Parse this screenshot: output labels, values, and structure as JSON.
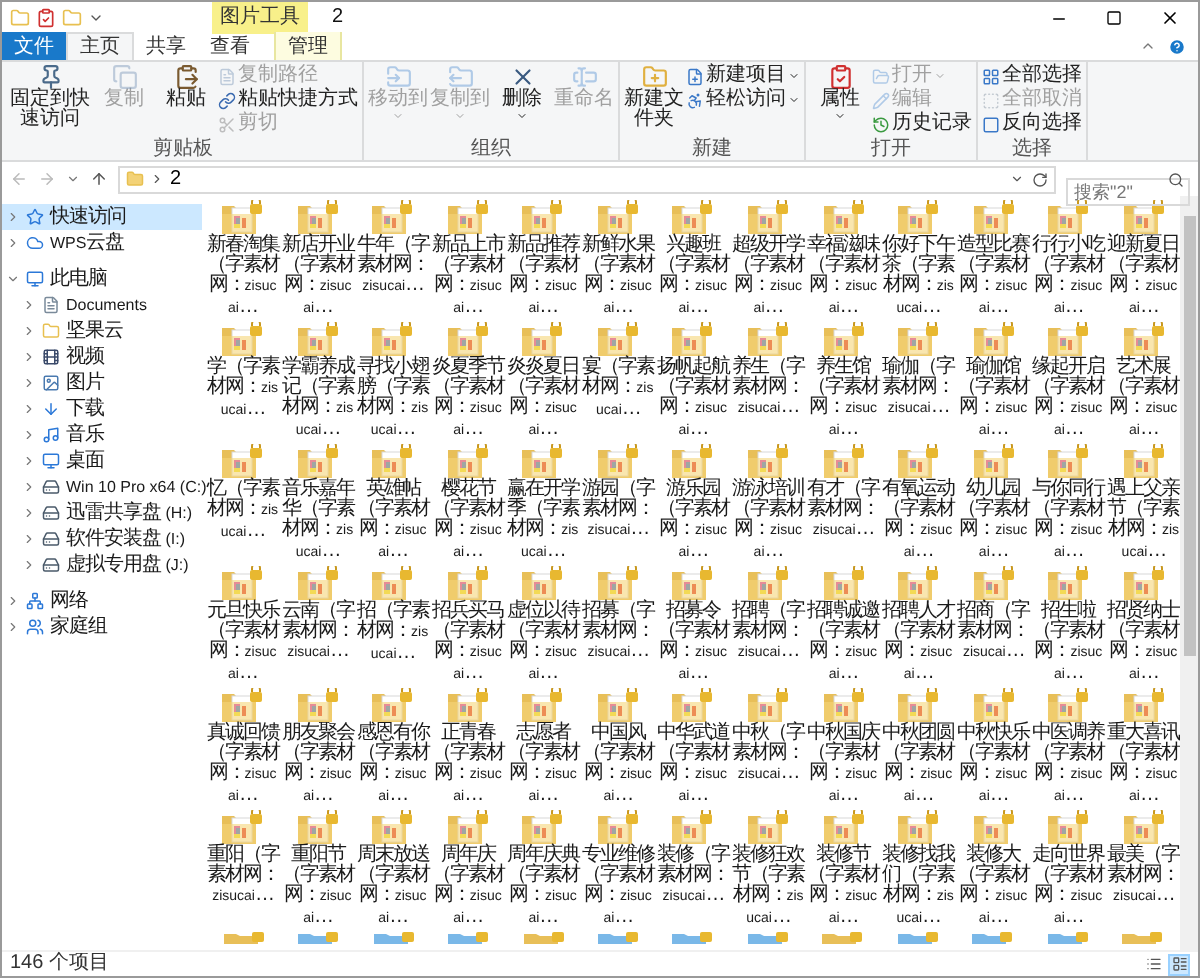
{
  "window": {
    "title": "2",
    "context_tab": "图片工具"
  },
  "ribbon_tabs": [
    {
      "label": "文件",
      "kind": "file",
      "selected": false
    },
    {
      "label": "主页",
      "kind": "tab",
      "selected": true
    },
    {
      "label": "共享",
      "kind": "tab",
      "selected": false
    },
    {
      "label": "查看",
      "kind": "tab",
      "selected": false
    },
    {
      "label": "管理",
      "kind": "context",
      "selected": false
    }
  ],
  "ribbon_groups": [
    {
      "label": "剪贴板",
      "items": [
        {
          "label": "固定到快速访问",
          "kind": "large",
          "disabled": false,
          "dropdown": false
        },
        {
          "label": "复制",
          "kind": "large",
          "disabled": true,
          "dropdown": false
        },
        {
          "label": "粘贴",
          "kind": "large",
          "disabled": false,
          "dropdown": false
        },
        {
          "label": "复制路径",
          "kind": "small",
          "disabled": true,
          "dropdown": false
        },
        {
          "label": "粘贴快捷方式",
          "kind": "small",
          "disabled": false,
          "dropdown": false
        },
        {
          "label": "剪切",
          "kind": "small",
          "disabled": true,
          "dropdown": false
        }
      ]
    },
    {
      "label": "组织",
      "items": [
        {
          "label": "移动到",
          "kind": "large",
          "disabled": true,
          "dropdown": true
        },
        {
          "label": "复制到",
          "kind": "large",
          "disabled": true,
          "dropdown": true
        },
        {
          "label": "删除",
          "kind": "large",
          "disabled": false,
          "dropdown": true
        },
        {
          "label": "重命名",
          "kind": "large",
          "disabled": true,
          "dropdown": false
        }
      ]
    },
    {
      "label": "新建",
      "items": [
        {
          "label": "新建文件夹",
          "kind": "large",
          "disabled": false,
          "dropdown": false
        },
        {
          "label": "新建项目",
          "kind": "small",
          "disabled": false,
          "dropdown": true
        },
        {
          "label": "轻松访问",
          "kind": "small",
          "disabled": false,
          "dropdown": true
        }
      ]
    },
    {
      "label": "打开",
      "items": [
        {
          "label": "属性",
          "kind": "large",
          "disabled": false,
          "dropdown": true
        },
        {
          "label": "打开",
          "kind": "small",
          "disabled": true,
          "dropdown": true
        },
        {
          "label": "编辑",
          "kind": "small",
          "disabled": true,
          "dropdown": false
        },
        {
          "label": "历史记录",
          "kind": "small",
          "disabled": false,
          "dropdown": false
        }
      ]
    },
    {
      "label": "选择",
      "items": [
        {
          "label": "全部选择",
          "kind": "small",
          "disabled": false,
          "dropdown": false
        },
        {
          "label": "全部取消",
          "kind": "small",
          "disabled": true,
          "dropdown": false
        },
        {
          "label": "反向选择",
          "kind": "small",
          "disabled": false,
          "dropdown": false
        }
      ]
    }
  ],
  "address": {
    "path": "2",
    "search_placeholder": "搜索\"2\""
  },
  "nav": [
    {
      "label": "快速访问",
      "selected": true,
      "expanded": false
    },
    {
      "label": "WPS云盘",
      "selected": false,
      "expanded": false
    },
    {
      "label": "此电脑",
      "selected": false,
      "expanded": true,
      "children": [
        {
          "label": "Documents",
          "selected": false,
          "expanded": false
        },
        {
          "label": "坚果云",
          "selected": false,
          "expanded": false
        },
        {
          "label": "视频",
          "selected": false,
          "expanded": false
        },
        {
          "label": "图片",
          "selected": false,
          "expanded": false
        },
        {
          "label": "下载",
          "selected": false,
          "expanded": false
        },
        {
          "label": "音乐",
          "selected": false,
          "expanded": false
        },
        {
          "label": "桌面",
          "selected": false,
          "expanded": false
        },
        {
          "label": "Win 10 Pro x64 (C:)",
          "selected": false,
          "expanded": false
        },
        {
          "label": "迅雷共享盘 (H:)",
          "selected": false,
          "expanded": false
        },
        {
          "label": "软件安装盘 (I:)",
          "selected": false,
          "expanded": false
        },
        {
          "label": "虚拟专用盘 (J:)",
          "selected": false,
          "expanded": false
        }
      ]
    },
    {
      "label": "网络",
      "selected": false,
      "expanded": false
    },
    {
      "label": "家庭组",
      "selected": false,
      "expanded": false
    }
  ],
  "files": [
    {
      "name": "新春淘集（字素材网：zisucai…"
    },
    {
      "name": "新店开业（字素材网：zisucai…"
    },
    {
      "name": "牛年（字素材网：zisucai…"
    },
    {
      "name": "新品上市（字素材网：zisucai…"
    },
    {
      "name": "新品推荐（字素材网：zisucai…"
    },
    {
      "name": "新鲜水果（字素材网：zisucai…"
    },
    {
      "name": "兴趣班（字素材网：zisucai…"
    },
    {
      "name": "超级开学（字素材网：zisucai…"
    },
    {
      "name": "幸福滋味（字素材网：zisucai…"
    },
    {
      "name": "你好下午茶（字素材网：zisucai…"
    },
    {
      "name": "造型比赛（字素材网：zisucai…"
    },
    {
      "name": "行行小吃（字素材网：zisucai…"
    },
    {
      "name": "迎新夏日（字素材网：zisucai…"
    },
    {
      "name": "学（字素材网：zisucai…"
    },
    {
      "name": "学霸养成记（字素材网：zisucai…"
    },
    {
      "name": "寻找小翅膀（字素材网：zisucai…"
    },
    {
      "name": "炎夏季节（字素材网：zisucai…"
    },
    {
      "name": "炎炎夏日（字素材网：zisucai…"
    },
    {
      "name": "宴（字素材网：zisucai…"
    },
    {
      "name": "扬帆起航（字素材网：zisucai…"
    },
    {
      "name": "养生（字素材网：zisucai…"
    },
    {
      "name": "养生馆（字素材网：zisucai…"
    },
    {
      "name": "瑜伽（字素材网：zisucai…"
    },
    {
      "name": "瑜伽馆（字素材网：zisucai…"
    },
    {
      "name": "缘起开启（字素材网：zisucai…"
    },
    {
      "name": "艺术展（字素材网：zisucai…"
    },
    {
      "name": "忆（字素材网：zisucai…"
    },
    {
      "name": "音乐嘉年华（字素材网：zisucai…"
    },
    {
      "name": "英雄帖（字素材网：zisucai…"
    },
    {
      "name": "樱花节（字素材网：zisucai…"
    },
    {
      "name": "赢在开学季（字素材网：zisucai…"
    },
    {
      "name": "游园（字素材网：zisucai…"
    },
    {
      "name": "游乐园（字素材网：zisucai…"
    },
    {
      "name": "游泳培训（字素材网：zisucai…"
    },
    {
      "name": "有才（字素材网：zisucai…"
    },
    {
      "name": "有氧运动（字素材网：zisucai…"
    },
    {
      "name": "幼儿园（字素材网：zisucai…"
    },
    {
      "name": "与你同行（字素材网：zisucai…"
    },
    {
      "name": "遇上父亲节（字素材网：zisucai…"
    },
    {
      "name": "元旦快乐（字素材网：zisucai…"
    },
    {
      "name": "云南（字素材网：zisucai…"
    },
    {
      "name": "招（字素材网：zisucai…"
    },
    {
      "name": "招兵买马（字素材网：zisucai…"
    },
    {
      "name": "虚位以待（字素材网：zisucai…"
    },
    {
      "name": "招募（字素材网：zisucai…"
    },
    {
      "name": "招募令（字素材网：zisucai…"
    },
    {
      "name": "招聘（字素材网：zisucai…"
    },
    {
      "name": "招聘诚邀（字素材网：zisucai…"
    },
    {
      "name": "招聘人才（字素材网：zisucai…"
    },
    {
      "name": "招商（字素材网：zisucai…"
    },
    {
      "name": "招生啦（字素材网：zisucai…"
    },
    {
      "name": "招贤纳士（字素材网：zisucai…"
    },
    {
      "name": "真诚回馈（字素材网：zisucai…"
    },
    {
      "name": "朋友聚会（字素材网：zisucai…"
    },
    {
      "name": "感恩有你（字素材网：zisucai…"
    },
    {
      "name": "正青春（字素材网：zisucai…"
    },
    {
      "name": "志愿者（字素材网：zisucai…"
    },
    {
      "name": "中国风（字素材网：zisucai…"
    },
    {
      "name": "中华武道（字素材网：zisucai…"
    },
    {
      "name": "中秋（字素材网：zisucai…"
    },
    {
      "name": "中秋国庆（字素材网：zisucai…"
    },
    {
      "name": "中秋团圆（字素材网：zisucai…"
    },
    {
      "name": "中秋快乐（字素材网：zisucai…"
    },
    {
      "name": "中医调养（字素材网：zisucai…"
    },
    {
      "name": "重大喜讯（字素材网：zisucai…"
    },
    {
      "name": "重阳（字素材网：zisucai…"
    },
    {
      "name": "重阳节（字素材网：zisucai…"
    },
    {
      "name": "周末放送（字素材网：zisucai…"
    },
    {
      "name": "周年庆（字素材网：zisucai…"
    },
    {
      "name": "周年庆典（字素材网：zisucai…"
    },
    {
      "name": "专业维修（字素材网：zisucai…"
    },
    {
      "name": "装修（字素材网：zisucai…"
    },
    {
      "name": "装修狂欢节（字素材网：zisucai…"
    },
    {
      "name": "装修节（字素材网：zisucai…"
    },
    {
      "name": "装修找我们（字素材网：zisucai…"
    },
    {
      "name": "装修大（字素材网：zisucai…"
    },
    {
      "name": "走向世界（字素材网：zisucai…"
    },
    {
      "name": "最美（字素材网：zisucai…"
    }
  ],
  "status_bar": {
    "count": "146 个项目"
  },
  "view_buttons": [
    {
      "selected": false
    },
    {
      "selected": true
    }
  ]
}
